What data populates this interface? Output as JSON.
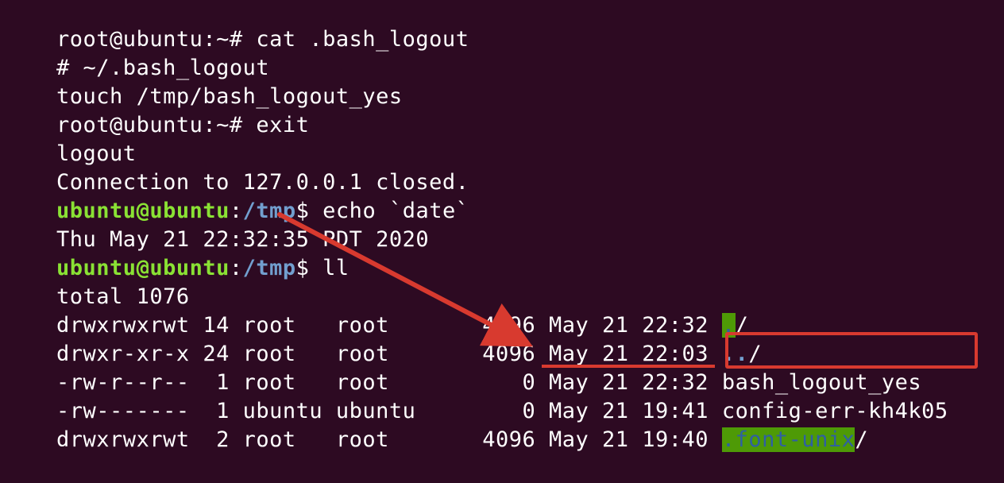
{
  "terminal": {
    "lines": [
      {
        "text": "root@ubuntu:~# cat .bash_logout"
      },
      {
        "text": "# ~/.bash_logout"
      },
      {
        "text": "touch /tmp/bash_logout_yes"
      },
      {
        "text": "root@ubuntu:~# exit"
      },
      {
        "text": "logout"
      },
      {
        "text": "Connection to 127.0.0.1 closed."
      },
      {
        "prompt_user": "ubuntu@ubuntu",
        "prompt_sep": ":",
        "prompt_path": "/tmp",
        "prompt_end": "$ ",
        "command": "echo `date`"
      },
      {
        "text": "Thu May 21 22:32:35 PDT 2020"
      },
      {
        "prompt_user": "ubuntu@ubuntu",
        "prompt_sep": ":",
        "prompt_path": "/tmp",
        "prompt_end": "$ ",
        "command": "ll"
      },
      {
        "text": "total 1076"
      },
      {
        "meta": "drwxrwxrwt 14 root   root       4096 May 21 22:32 ",
        "name": ".",
        "suffix": "/"
      },
      {
        "meta": "drwxr-xr-x 24 root   root       4096 May 21 22:03 ",
        "name": "..",
        "suffix": "/"
      },
      {
        "meta": "-rw-r--r--  1 root   root          0 May 21 22:32 ",
        "name": "bash_logout_yes",
        "suffix": ""
      },
      {
        "meta": "-rw-------  1 ubuntu ubuntu        0 May 21 19:41 ",
        "name": "config-err-kh4k05",
        "suffix": ""
      },
      {
        "meta": "drwxrwxrwt  2 root   root       4096 May 21 19:40 ",
        "name": ".font-unix",
        "suffix": "/"
      }
    ]
  },
  "annotation": {
    "color": "#d83a2f"
  }
}
